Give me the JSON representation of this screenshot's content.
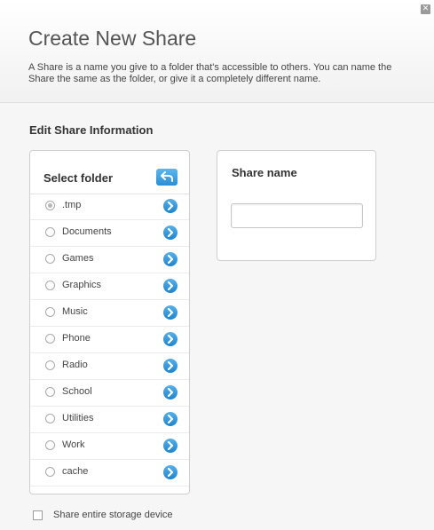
{
  "dialog": {
    "title": "Create New Share",
    "description": "A Share is a name you give to a folder that's accessible to others. You can name the Share the same as the folder, or give it a completely different name.",
    "close_icon": "close-x-icon"
  },
  "section": {
    "title": "Edit Share Information"
  },
  "folder_panel": {
    "label": "Select folder",
    "back_icon": "back-arrow-icon",
    "selected": ".tmp",
    "items": [
      {
        "label": ".tmp",
        "selected": true
      },
      {
        "label": "Documents",
        "selected": false
      },
      {
        "label": "Games",
        "selected": false
      },
      {
        "label": "Graphics",
        "selected": false
      },
      {
        "label": "Music",
        "selected": false
      },
      {
        "label": "Phone",
        "selected": false
      },
      {
        "label": "Radio",
        "selected": false
      },
      {
        "label": "School",
        "selected": false
      },
      {
        "label": "Utilities",
        "selected": false
      },
      {
        "label": "Work",
        "selected": false
      },
      {
        "label": "cache",
        "selected": false
      }
    ]
  },
  "share_panel": {
    "label": "Share name",
    "value": ""
  },
  "entire_device": {
    "label": "Share entire storage device",
    "checked": false
  },
  "colors": {
    "accent": "#2a8fd4",
    "background": "#f6f6f6"
  }
}
